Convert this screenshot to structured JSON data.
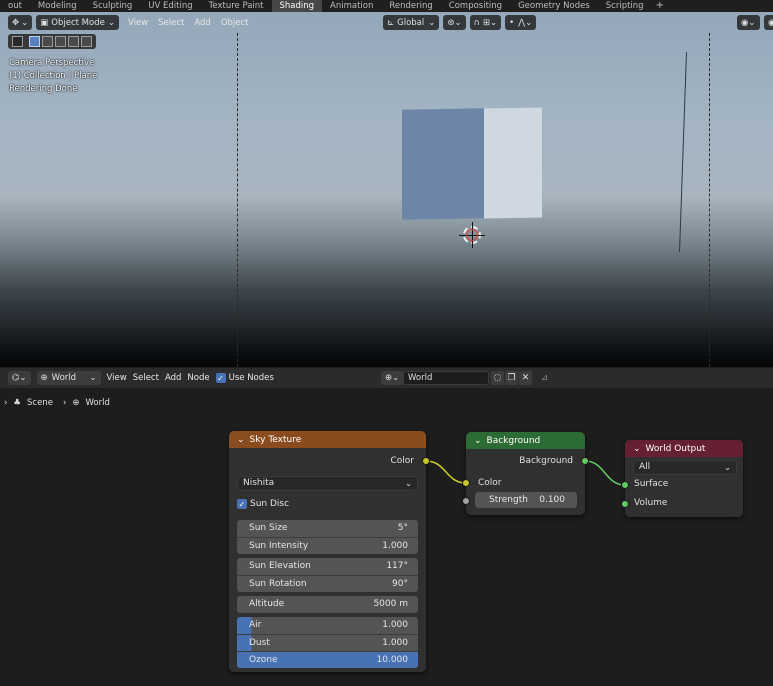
{
  "workspace_tabs": [
    "out",
    "Modeling",
    "Sculpting",
    "UV Editing",
    "Texture Paint",
    "Shading",
    "Animation",
    "Rendering",
    "Compositing",
    "Geometry Nodes",
    "Scripting"
  ],
  "active_tab": "Shading",
  "viewport": {
    "mode": "Object Mode",
    "menus": [
      "View",
      "Select",
      "Add",
      "Object"
    ],
    "transform_orientation": "Global",
    "info": {
      "line1": "Camera Perspective",
      "line2": "(1) Collection | Plane",
      "line3": "Rendering Done"
    }
  },
  "node_editor": {
    "shader_type": "World",
    "menus": [
      "View",
      "Select",
      "Add",
      "Node"
    ],
    "use_nodes_label": "Use Nodes",
    "world_name": "World",
    "breadcrumb": [
      "Scene",
      "World"
    ]
  },
  "nodes": {
    "sky_texture": {
      "title": "Sky Texture",
      "output_color": "Color",
      "sky_type": "Nishita",
      "sun_disc_label": "Sun Disc",
      "sun_size": {
        "label": "Sun Size",
        "value": "5°"
      },
      "sun_intensity": {
        "label": "Sun Intensity",
        "value": "1.000"
      },
      "sun_elevation": {
        "label": "Sun Elevation",
        "value": "117°"
      },
      "sun_rotation": {
        "label": "Sun Rotation",
        "value": "90°"
      },
      "altitude": {
        "label": "Altitude",
        "value": "5000 m"
      },
      "air": {
        "label": "Air",
        "value": "1.000"
      },
      "dust": {
        "label": "Dust",
        "value": "1.000"
      },
      "ozone": {
        "label": "Ozone",
        "value": "10.000"
      }
    },
    "background": {
      "title": "Background",
      "output": "Background",
      "input_color": "Color",
      "strength": {
        "label": "Strength",
        "value": "0.100"
      }
    },
    "world_output": {
      "title": "World Output",
      "target": "All",
      "input_surface": "Surface",
      "input_volume": "Volume"
    }
  },
  "colors": {
    "header_texture": "#8a4c1f",
    "header_shader": "#2d6b34",
    "header_output": "#652133",
    "socket_color": "#c7c729",
    "socket_shader": "#63c763",
    "accent_blue": "#4772b3"
  }
}
